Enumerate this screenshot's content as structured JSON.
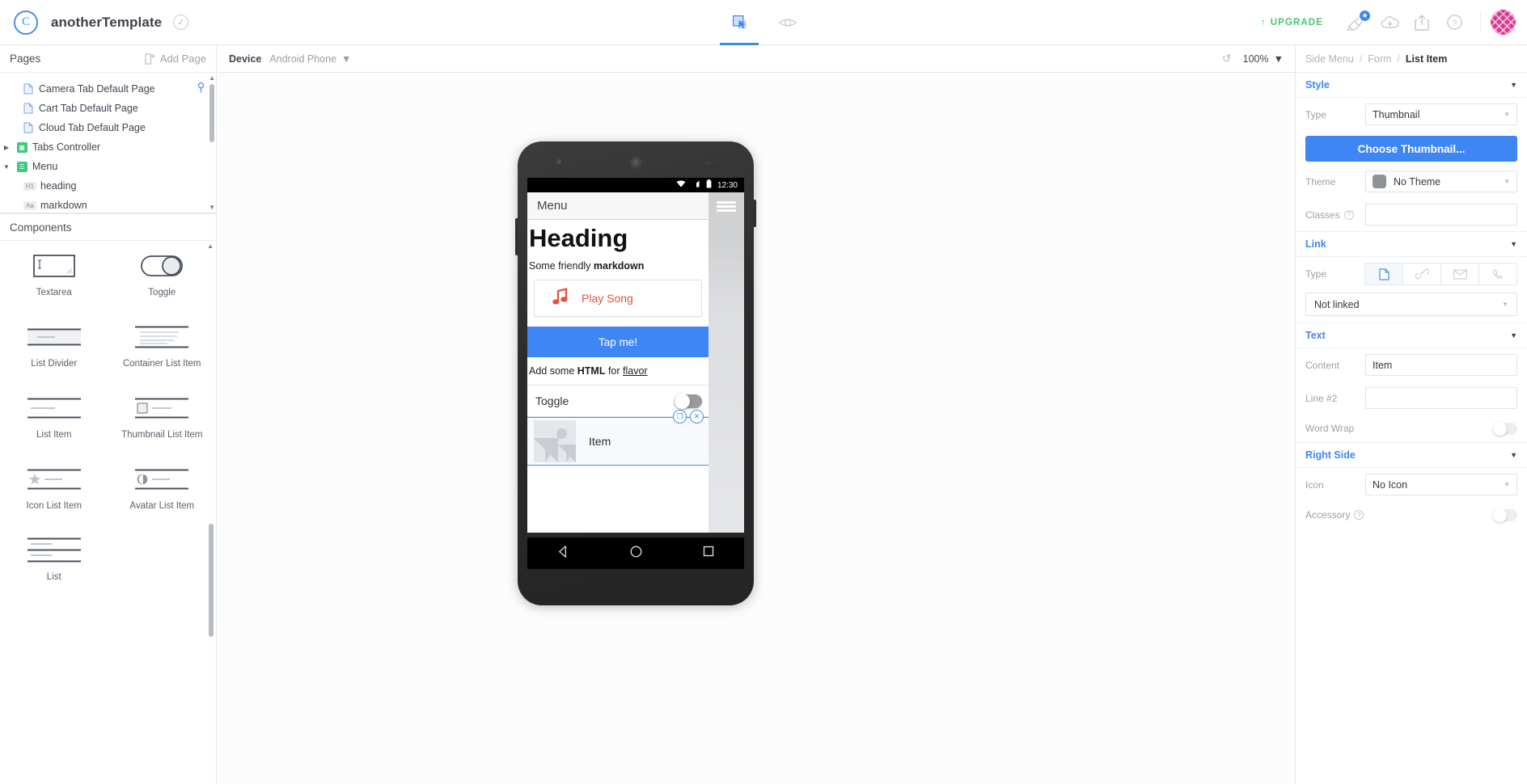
{
  "topbar": {
    "logo_glyph": "C",
    "project_title": "anotherTemplate",
    "saved_check_glyph": "✓",
    "modes": [
      {
        "name": "design",
        "glyph": "design-icon",
        "active": true
      },
      {
        "name": "preview",
        "glyph": "eye-icon",
        "active": false
      }
    ],
    "upgrade_label": "UPGRADE",
    "upgrade_arrow": "↑",
    "upgrade_color": "#41c96b",
    "icons": [
      {
        "name": "paintbrush-icon",
        "badge": "★"
      },
      {
        "name": "cloud-download-icon"
      },
      {
        "name": "share-upload-icon"
      },
      {
        "name": "help-icon",
        "glyph": "?"
      }
    ]
  },
  "pages_panel": {
    "title": "Pages",
    "add_page_label": "Add Page",
    "items": [
      {
        "label": "Camera Tab Default Page",
        "icon": "document-icon",
        "indent": 1,
        "twisty": "",
        "pinned": true
      },
      {
        "label": "Cart Tab Default Page",
        "icon": "document-icon",
        "indent": 1,
        "twisty": "",
        "pinned": false
      },
      {
        "label": "Cloud Tab Default Page",
        "icon": "document-icon",
        "indent": 1,
        "twisty": "",
        "pinned": false
      },
      {
        "label": "Tabs Controller",
        "icon": "tabs-icon",
        "indent": 0,
        "twisty": "▶",
        "pinned": false
      },
      {
        "label": "Menu",
        "icon": "menu-page-icon",
        "indent": 0,
        "twisty": "▼",
        "pinned": false
      },
      {
        "label": "heading",
        "icon": "h1-icon",
        "indent": 2,
        "twisty": "",
        "pinned": false
      },
      {
        "label": "markdown",
        "icon": "aa-icon",
        "indent": 2,
        "twisty": "",
        "pinned": false
      }
    ]
  },
  "components_panel": {
    "title": "Components",
    "items": [
      {
        "label": "Textarea",
        "art": "textarea"
      },
      {
        "label": "Toggle",
        "art": "toggle"
      },
      {
        "label": "List Divider",
        "art": "list-divider"
      },
      {
        "label": "Container List Item",
        "art": "container-list-item"
      },
      {
        "label": "List Item",
        "art": "list-item"
      },
      {
        "label": "Thumbnail List Item",
        "art": "thumbnail-list-item"
      },
      {
        "label": "Icon List Item",
        "art": "icon-list-item"
      },
      {
        "label": "Avatar List Item",
        "art": "avatar-list-item"
      },
      {
        "label": "List",
        "art": "list"
      }
    ]
  },
  "canvas_toolbar": {
    "device_label": "Device",
    "device_value": "Android Phone",
    "refresh_icon": "refresh-icon",
    "zoom_level": "100%"
  },
  "phone": {
    "status_time": "12:30",
    "app_title": "Menu",
    "heading": "Heading",
    "markdown_plain": "Some friendly ",
    "markdown_bold": "markdown",
    "play_song_label": "Play Song",
    "play_song_color": "#e8503a",
    "music_note_glyph": "♫",
    "tap_button_label": "Tap me!",
    "tap_button_color": "#3f86f5",
    "html_line_pre": "Add some ",
    "html_line_bold": "HTML",
    "html_line_mid": " for ",
    "html_line_link": "flavor",
    "toggle_label": "Toggle",
    "item_label": "Item",
    "selection_handles": [
      {
        "name": "duplicate-handle",
        "glyph": "❐"
      },
      {
        "name": "delete-handle",
        "glyph": "✕"
      }
    ],
    "nav_buttons": [
      "◁",
      "◯",
      "▢"
    ]
  },
  "inspector": {
    "breadcrumb": [
      "Side Menu",
      "Form",
      "List Item"
    ],
    "breadcrumb_separator": "/",
    "sections": {
      "style": {
        "title": "Style",
        "type_label": "Type",
        "type_value": "Thumbnail",
        "choose_thumbnail_label": "Choose Thumbnail...",
        "theme_label": "Theme",
        "theme_value": "No Theme",
        "classes_label": "Classes",
        "classes_value": ""
      },
      "link": {
        "title": "Link",
        "type_label": "Type",
        "types": [
          {
            "name": "page-link-icon",
            "active": true
          },
          {
            "name": "url-link-icon",
            "active": false
          },
          {
            "name": "email-link-icon",
            "active": false
          },
          {
            "name": "phone-link-icon",
            "active": false
          }
        ],
        "target_value": "Not linked"
      },
      "text": {
        "title": "Text",
        "content_label": "Content",
        "content_value": "Item",
        "line2_label": "Line #2",
        "line2_value": "",
        "word_wrap_label": "Word Wrap",
        "word_wrap_on": false
      },
      "right_side": {
        "title": "Right Side",
        "icon_label": "Icon",
        "icon_value": "No Icon",
        "accessory_label": "Accessory",
        "accessory_on": false
      }
    }
  }
}
